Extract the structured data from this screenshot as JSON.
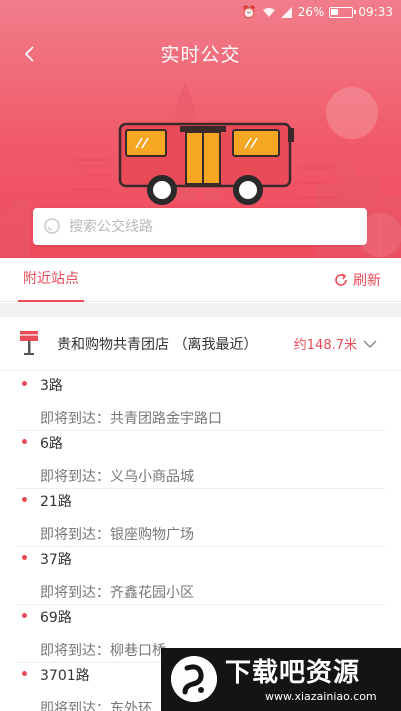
{
  "status_bar": {
    "battery": "26%",
    "time": "09:33"
  },
  "header": {
    "title": "实时公交",
    "back_icon": "back-arrow-icon"
  },
  "search": {
    "placeholder": "搜索公交线路",
    "value": ""
  },
  "tabs": {
    "nearby_label": "附近站点",
    "refresh_label": "刷新"
  },
  "station": {
    "name": "贵和购物共青团店 （离我最近）",
    "distance": "约148.7米"
  },
  "routes": [
    {
      "number": "3路",
      "arrive": "即将到达：共青团路金宇路口"
    },
    {
      "number": "6路",
      "arrive": "即将到达：义乌小商品城"
    },
    {
      "number": "21路",
      "arrive": "即将到达：银座购物广场"
    },
    {
      "number": "37路",
      "arrive": "即将到达：齐鑫花园小区"
    },
    {
      "number": "69路",
      "arrive": "即将到达：柳巷口桥"
    },
    {
      "number": "3701路",
      "arrive": "即将到达：东外环"
    }
  ],
  "watermark": {
    "title": "下载吧资源",
    "url": "www.xiazainiao.com"
  },
  "colors": {
    "accent": "#e94b58",
    "header_top": "#f17d8a",
    "header_bottom": "#ee4a5c"
  }
}
